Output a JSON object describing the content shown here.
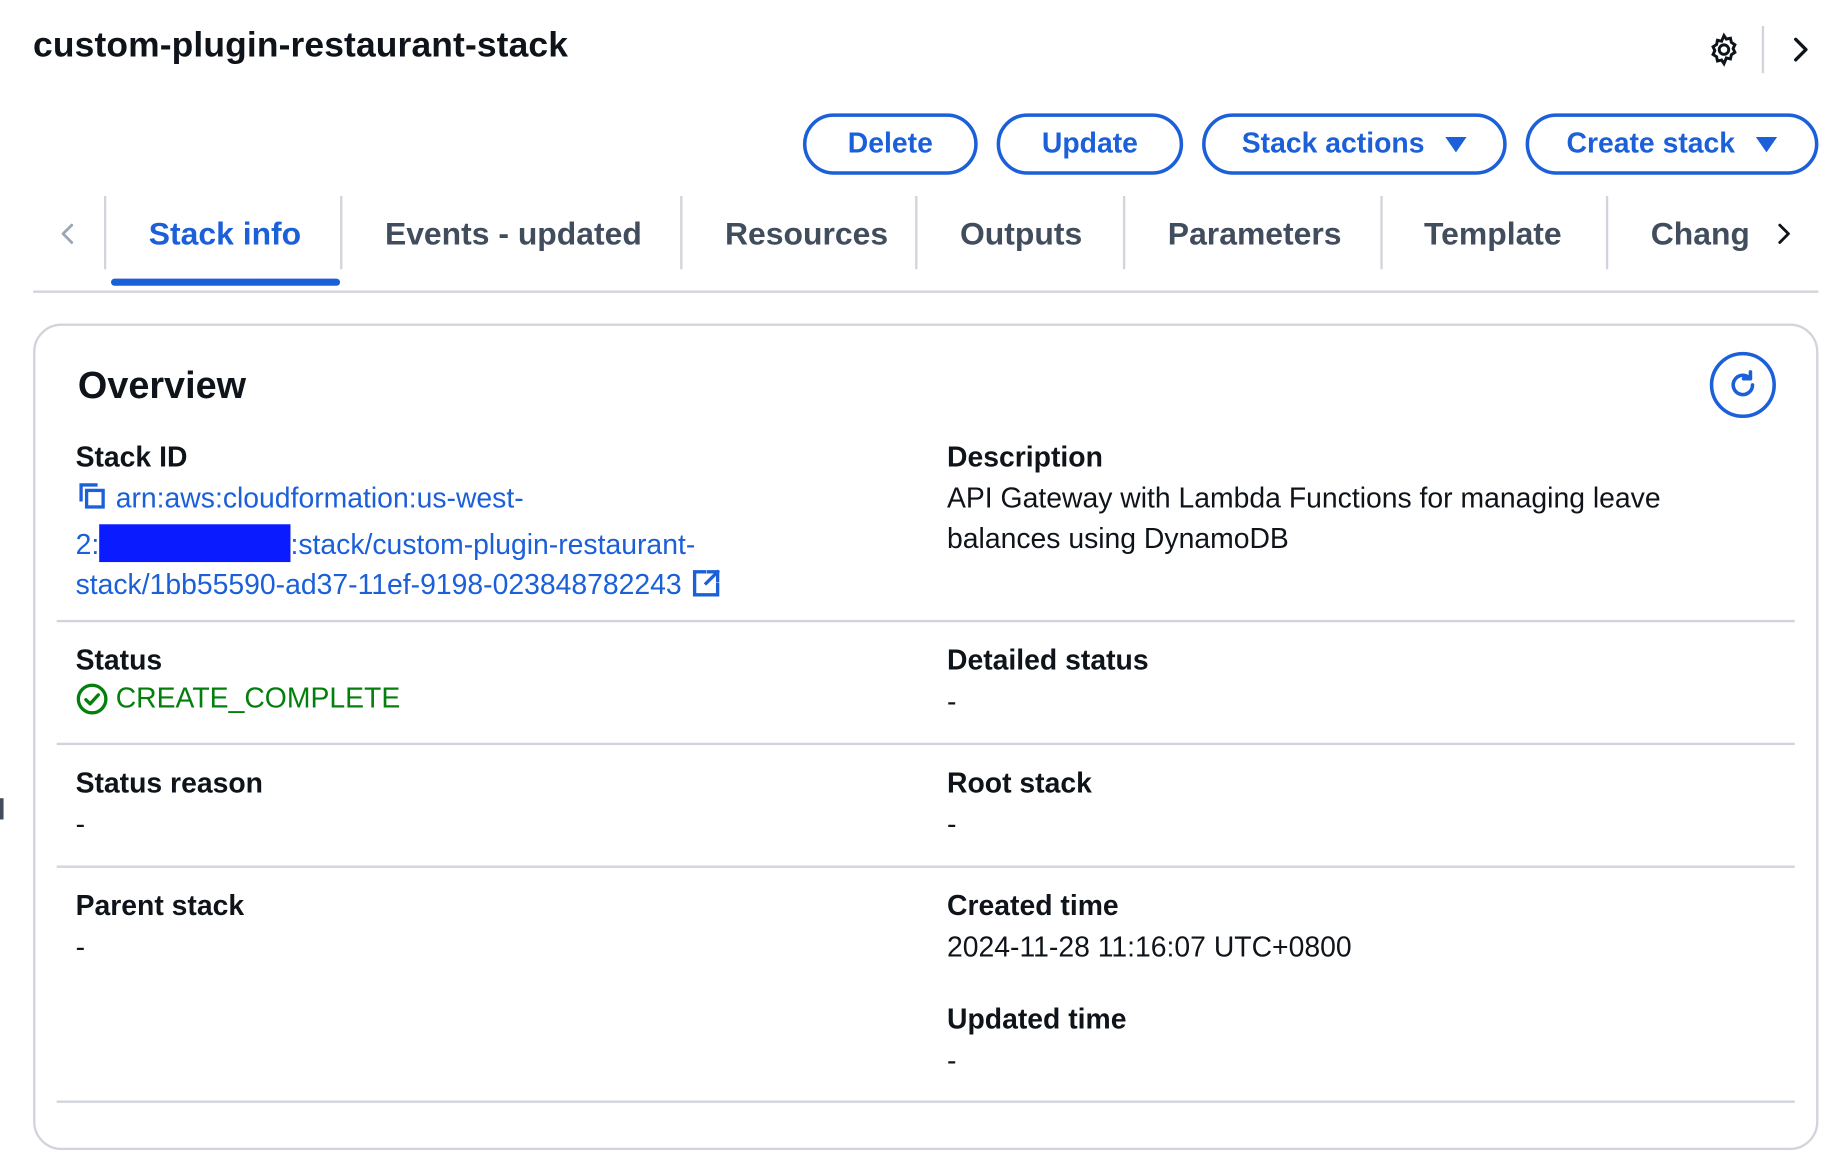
{
  "page": {
    "title": "custom-plugin-restaurant-stack"
  },
  "icons": {
    "settings": "gear-icon",
    "collapse": "chevron-right-icon",
    "refresh": "refresh-icon",
    "copy": "copy-icon",
    "external": "external-link-icon",
    "status": "check-circle-icon"
  },
  "actions": {
    "delete_label": "Delete",
    "update_label": "Update",
    "stack_actions_label": "Stack actions",
    "create_stack_label": "Create stack"
  },
  "tabs": [
    {
      "label": "Stack info",
      "active": true
    },
    {
      "label": "Events - updated",
      "active": false
    },
    {
      "label": "Resources",
      "active": false
    },
    {
      "label": "Outputs",
      "active": false
    },
    {
      "label": "Parameters",
      "active": false
    },
    {
      "label": "Template",
      "active": false
    },
    {
      "label": "Chang",
      "active": false
    }
  ],
  "overview": {
    "title": "Overview",
    "stack_id": {
      "label": "Stack ID",
      "line1": "arn:aws:cloudformation:us-west-",
      "line2_prefix": "2:",
      "line2_suffix": ":stack/custom-plugin-restaurant-",
      "line3": "stack/1bb55590-ad37-11ef-9198-023848782243"
    },
    "description": {
      "label": "Description",
      "value": "API Gateway with Lambda Functions for managing leave balances using DynamoDB"
    },
    "status": {
      "label": "Status",
      "value": "CREATE_COMPLETE"
    },
    "detailed_status": {
      "label": "Detailed status",
      "value": "-"
    },
    "status_reason": {
      "label": "Status reason",
      "value": "-"
    },
    "root_stack": {
      "label": "Root stack",
      "value": "-"
    },
    "parent_stack": {
      "label": "Parent stack",
      "value": "-"
    },
    "created_time": {
      "label": "Created time",
      "value": "2024-11-28 11:16:07 UTC+0800"
    },
    "updated_time": {
      "label": "Updated time",
      "value": "-"
    }
  },
  "colors": {
    "accent": "#1b5fd9",
    "success": "#037f0c",
    "redaction": "#0a1cff"
  }
}
